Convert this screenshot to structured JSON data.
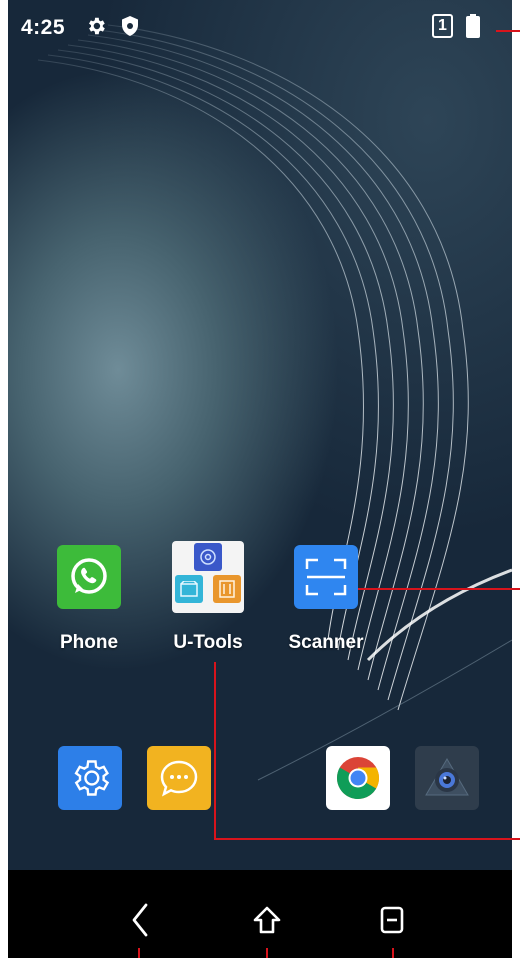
{
  "status_bar": {
    "time": "4:25",
    "sim_slot": "1"
  },
  "home": {
    "apps": [
      {
        "label": "Phone",
        "icon": "phone-icon"
      },
      {
        "label": "U-Tools",
        "icon": "u-tools-icon"
      },
      {
        "label": "Scanner",
        "icon": "scanner-icon"
      }
    ],
    "dock": [
      {
        "icon": "settings-icon"
      },
      {
        "icon": "messages-icon"
      },
      {
        "icon": "chrome-icon"
      },
      {
        "icon": "camera-icon"
      }
    ]
  },
  "nav_bar": {
    "buttons": [
      "back",
      "home",
      "recents"
    ]
  },
  "colors": {
    "phone_green": "#3dbb3a",
    "scanner_blue": "#2f86f0",
    "settings_blue": "#2d7fe8",
    "messages_yellow": "#f2b320",
    "annotation_red": "#d8141c"
  }
}
